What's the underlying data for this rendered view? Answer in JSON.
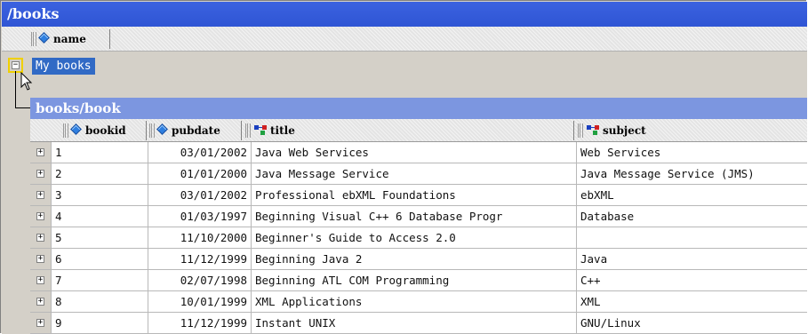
{
  "outer": {
    "title": "/books",
    "columns": [
      {
        "label": "name"
      }
    ],
    "row": {
      "label": "My books"
    }
  },
  "inner": {
    "title": "books/book",
    "columns": {
      "bookid": "bookid",
      "pubdate": "pubdate",
      "title": "title",
      "subject": "subject"
    },
    "rows": [
      {
        "bookid": "1",
        "pubdate": "03/01/2002",
        "title": "Java Web Services",
        "subject": "Web Services"
      },
      {
        "bookid": "2",
        "pubdate": "01/01/2000",
        "title": "Java Message Service",
        "subject": "Java Message Service (JMS)"
      },
      {
        "bookid": "3",
        "pubdate": "03/01/2002",
        "title": "Professional ebXML Foundations",
        "subject": "ebXML"
      },
      {
        "bookid": "4",
        "pubdate": "01/03/1997",
        "title": "Beginning Visual C++ 6 Database Progr",
        "subject": "Database"
      },
      {
        "bookid": "5",
        "pubdate": "11/10/2000",
        "title": "Beginner's Guide to Access 2.0",
        "subject": ""
      },
      {
        "bookid": "6",
        "pubdate": "11/12/1999",
        "title": "Beginning Java 2",
        "subject": "Java"
      },
      {
        "bookid": "7",
        "pubdate": "02/07/1998",
        "title": "Beginning ATL COM Programming",
        "subject": "C++"
      },
      {
        "bookid": "8",
        "pubdate": "10/01/1999",
        "title": "XML Applications",
        "subject": "XML"
      },
      {
        "bookid": "9",
        "pubdate": "11/12/1999",
        "title": "Instant UNIX",
        "subject": "GNU/Linux"
      }
    ]
  },
  "icons": {
    "attribute": "attribute-diamond-icon",
    "element": "element-icon",
    "expand": "plus-expander-icon",
    "collapse": "minus-collapser-icon",
    "cursor": "mouse-pointer-icon"
  },
  "colors": {
    "title_bar": "#2f55d4",
    "inner_title_bar": "#7c96e0",
    "selection": "#316ac5"
  }
}
